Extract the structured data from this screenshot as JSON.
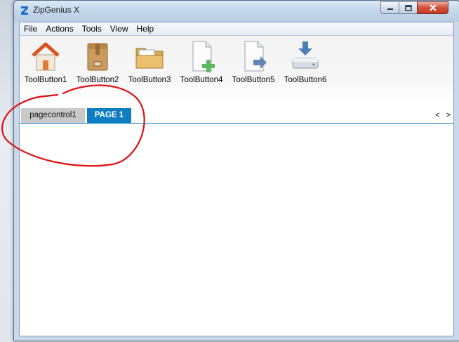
{
  "window": {
    "title": "ZipGenius X"
  },
  "menu": [
    "File",
    "Actions",
    "Tools",
    "View",
    "Help"
  ],
  "toolbar": [
    {
      "label": "ToolButton1",
      "icon": "home-icon"
    },
    {
      "label": "ToolButton2",
      "icon": "package-icon"
    },
    {
      "label": "ToolButton3",
      "icon": "folder-icon"
    },
    {
      "label": "ToolButton4",
      "icon": "add-file-icon"
    },
    {
      "label": "ToolButton5",
      "icon": "export-file-icon"
    },
    {
      "label": "ToolButton6",
      "icon": "download-drive-icon"
    }
  ],
  "tabs": [
    {
      "label": "pagecontrol1",
      "active": false
    },
    {
      "label": "PAGE 1",
      "active": true
    }
  ],
  "tab_scroll": {
    "left": "<",
    "right": ">"
  },
  "colors": {
    "active_tab": "#0f7dc2",
    "annotation": "#e01010"
  }
}
